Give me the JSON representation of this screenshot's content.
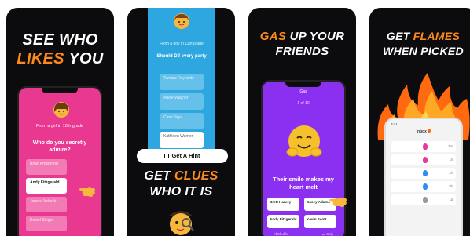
{
  "panel1": {
    "headline_line1": "SEE WHO",
    "headline_line2_a": "LIKES",
    "headline_line2_b": "YOU",
    "poll_source": "From a girl in 10th grade",
    "question": "Who do you secretly admire?",
    "options": [
      {
        "name": "Brian Armstrong",
        "selected": false
      },
      {
        "name": "Andy Fitzgerald",
        "selected": true
      },
      {
        "name": "James Jerbeck",
        "selected": false
      },
      {
        "name": "Daniel Singer",
        "selected": false
      }
    ]
  },
  "panel2": {
    "poll_source": "From a boy in 11th grade",
    "question": "Should DJ every party",
    "options": [
      "Tamara Reynolds",
      "Addie Wagner",
      "Cami Skye",
      "Kathleen Warner"
    ],
    "hint_button": "Get A Hint",
    "headline_line1_a": "GET",
    "headline_line1_b": "CLUES",
    "headline_line2": "WHO IT IS"
  },
  "panel3": {
    "headline_line1_a": "GAS",
    "headline_line1_b": "UP YOUR",
    "headline_line2": "FRIENDS",
    "screen_title": "Gas",
    "counter": "1 of 10",
    "question": "Their smile makes my heart melt",
    "options": [
      "Brett Harvey",
      "Casey Adams",
      "Andy Fitzgerald",
      "Kevin Scott"
    ],
    "footer_left": "Shuffle",
    "footer_right": "Skip"
  },
  "panel4": {
    "headline_line1_a": "GET",
    "headline_line1_b": "FLAMES",
    "headline_line2": "WHEN PICKED",
    "time": "9:41",
    "inbox_title": "Inbox",
    "rows": [
      {
        "color": "#e6399b",
        "time": "3m"
      },
      {
        "color": "#e6399b",
        "time": "1h"
      },
      {
        "color": "#2f8cf0",
        "time": "2h"
      },
      {
        "color": "#2f8cf0",
        "time": "5h"
      },
      {
        "color": "#9a9a9a",
        "time": "1d"
      }
    ]
  },
  "colors": {
    "panel_bg": "#0c0c0e",
    "accent_orange": "#ff8a1c",
    "pink_screen": "#e9388f",
    "blue_screen": "#2ea7e0",
    "purple_screen": "#8b2ff0"
  }
}
